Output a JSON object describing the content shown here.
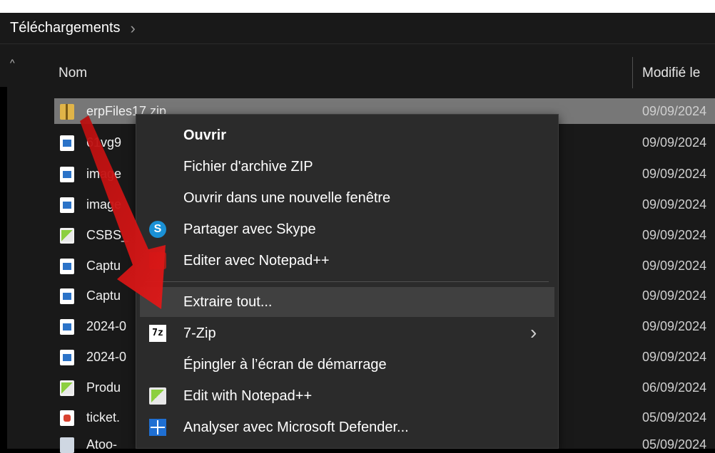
{
  "breadcrumb": {
    "folder": "Téléchargements",
    "separator": "›"
  },
  "columns": {
    "name": "Nom",
    "modified": "Modifié le"
  },
  "files": [
    {
      "name": "erpFiles17.zip",
      "date": "09/09/2024",
      "icon": "zip-folder-icon",
      "selected": true
    },
    {
      "name": "61vg9",
      "date": "09/09/2024",
      "icon": "image-file-icon"
    },
    {
      "name": "image",
      "date": "09/09/2024",
      "icon": "image-file-icon"
    },
    {
      "name": "image",
      "date": "09/09/2024",
      "icon": "image-file-icon"
    },
    {
      "name": "CSBS_",
      "date": "09/09/2024",
      "icon": "notepad-file-icon"
    },
    {
      "name": "Captu",
      "date": "09/09/2024",
      "icon": "image-file-icon"
    },
    {
      "name": "Captu",
      "date": "09/09/2024",
      "icon": "image-file-icon"
    },
    {
      "name": "2024-0",
      "date": "09/09/2024",
      "icon": "image-file-icon"
    },
    {
      "name": "2024-0",
      "date": "09/09/2024",
      "icon": "image-file-icon"
    },
    {
      "name": "Produ",
      "date": "06/09/2024",
      "icon": "notepad-file-icon"
    },
    {
      "name": "ticket.",
      "date": "05/09/2024",
      "icon": "pdf-file-icon"
    },
    {
      "name": "Atoo-",
      "date": "05/09/2024",
      "icon": "app-file-icon"
    }
  ],
  "context_menu": {
    "items": [
      {
        "label": "Ouvrir",
        "bold": true,
        "icon": ""
      },
      {
        "label": "Fichier d'archive ZIP",
        "icon": ""
      },
      {
        "label": "Ouvrir dans une nouvelle fenêtre",
        "icon": ""
      },
      {
        "label": "Partager avec Skype",
        "icon": "skype-icon"
      },
      {
        "label": "Editer avec Notepad++",
        "icon": "notepad-plus-plus-icon"
      },
      {
        "label": "Extraire tout...",
        "icon": "",
        "highlighted": true
      },
      {
        "label": "7-Zip",
        "icon": "seven-zip-icon",
        "submenu": true
      },
      {
        "label": "Épingler à l’écran de démarrage",
        "icon": ""
      },
      {
        "label": "Edit with Notepad++",
        "icon": "notepad-plus-plus-icon"
      },
      {
        "label": "Analyser avec Microsoft Defender...",
        "icon": "windows-defender-icon"
      }
    ],
    "skype_glyph": "S",
    "seven_zip_glyph": "7z",
    "chevron": "›"
  },
  "colors": {
    "background": "#191919",
    "menu": "#2b2b2b",
    "selection": "#777777",
    "annotation_arrow": "#d01010"
  }
}
